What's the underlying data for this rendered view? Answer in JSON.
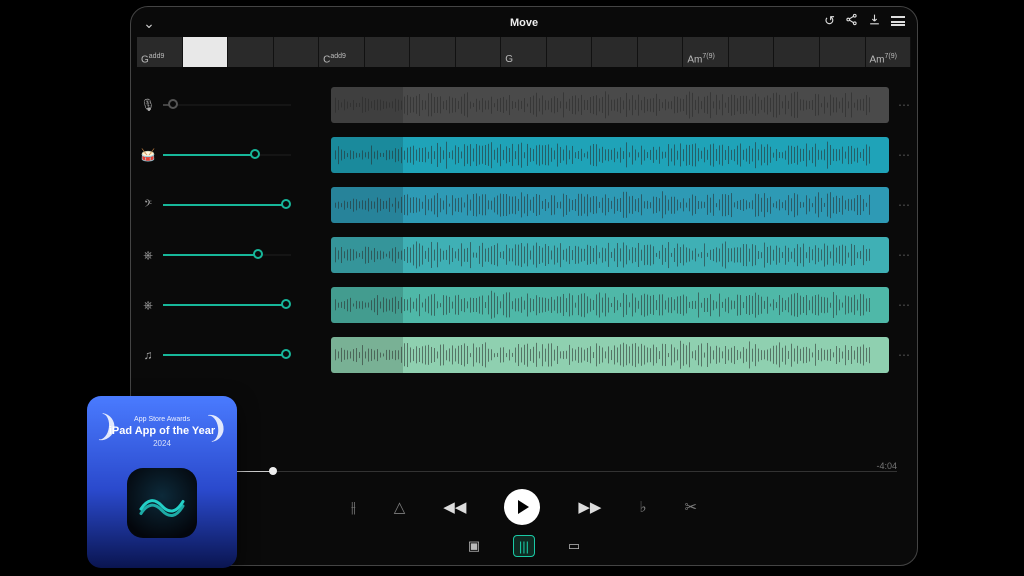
{
  "header": {
    "title": "Move",
    "actions": {
      "undo": "↺",
      "share": "share",
      "download": "download",
      "menu": "menu"
    }
  },
  "chords": [
    {
      "root": "G",
      "ext": "add9",
      "selected": false
    },
    {
      "root": "",
      "ext": "",
      "selected": true
    },
    {
      "root": "",
      "ext": ""
    },
    {
      "root": "",
      "ext": ""
    },
    {
      "root": "C",
      "ext": "add9"
    },
    {
      "root": "",
      "ext": ""
    },
    {
      "root": "",
      "ext": ""
    },
    {
      "root": "",
      "ext": ""
    },
    {
      "root": "G",
      "ext": ""
    },
    {
      "root": "",
      "ext": ""
    },
    {
      "root": "",
      "ext": ""
    },
    {
      "root": "",
      "ext": ""
    },
    {
      "root": "Am",
      "ext": "7(9)"
    },
    {
      "root": "",
      "ext": ""
    },
    {
      "root": "",
      "ext": ""
    },
    {
      "root": "",
      "ext": ""
    },
    {
      "root": "Am",
      "ext": "7(9)"
    }
  ],
  "tracks": [
    {
      "icon": "mic",
      "vol": 8,
      "color": "#4a4a4a",
      "gray": true
    },
    {
      "icon": "drums",
      "vol": 72,
      "color": "#1fa3b8"
    },
    {
      "icon": "bass",
      "vol": 96,
      "color": "#2e9ab5"
    },
    {
      "icon": "keys1",
      "vol": 74,
      "color": "#3fb0b5"
    },
    {
      "icon": "keys2",
      "vol": 96,
      "color": "#4fb8a8"
    },
    {
      "icon": "notes",
      "vol": 96,
      "color": "#8fd0b0"
    }
  ],
  "icons": {
    "mic": "🎙",
    "drums": "🥁",
    "bass": "𝄢",
    "keys1": "⎈",
    "keys2": "⎈",
    "notes": "♫"
  },
  "timeline": {
    "progress_pct": 14,
    "time_remaining": "-4:04"
  },
  "transport": {
    "metronome": "⫲",
    "tempo": "△",
    "rew": "◀◀",
    "play": "►",
    "ffw": "▶▶",
    "flat": "♭",
    "cut": "✂"
  },
  "tabs": {
    "chat": "▣",
    "mixer": "|||",
    "video": "▭"
  },
  "award": {
    "top_line": "App Store Awards",
    "main_line": "iPad App of the Year",
    "year": "2024"
  }
}
